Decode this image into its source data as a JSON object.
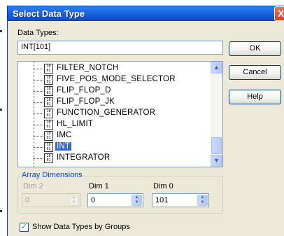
{
  "window": {
    "title": "Select Data Type",
    "close_glyph": "X"
  },
  "data_types": {
    "label": "Data Types:",
    "value": "INT[101]",
    "items": [
      {
        "name": "FILTER_NOTCH",
        "selected": false
      },
      {
        "name": "FIVE_POS_MODE_SELECTOR",
        "selected": false
      },
      {
        "name": "FLIP_FLOP_D",
        "selected": false
      },
      {
        "name": "FLIP_FLOP_JK",
        "selected": false
      },
      {
        "name": "FUNCTION_GENERATOR",
        "selected": false
      },
      {
        "name": "HL_LIMIT",
        "selected": false
      },
      {
        "name": "IMC",
        "selected": false
      },
      {
        "name": "INT",
        "selected": true
      },
      {
        "name": "INTEGRATOR",
        "selected": false
      }
    ],
    "item_icon": "data-type-icon"
  },
  "buttons": {
    "ok": "OK",
    "cancel": "Cancel",
    "help": "Help"
  },
  "array_dimensions": {
    "title": "Array Dimensions",
    "dim2": {
      "label": "Dim 2",
      "value": "0"
    },
    "dim1": {
      "label": "Dim 1",
      "value": "0"
    },
    "dim0": {
      "label": "Dim 0",
      "value": "101"
    }
  },
  "show_groups": {
    "label": "Show Data Types by Groups",
    "checked": true
  },
  "colors": {
    "title_bar": "#0a5fd8",
    "selection": "#316ac5",
    "dialog_bg": "#ece9d8",
    "group_title": "#0046d5"
  }
}
